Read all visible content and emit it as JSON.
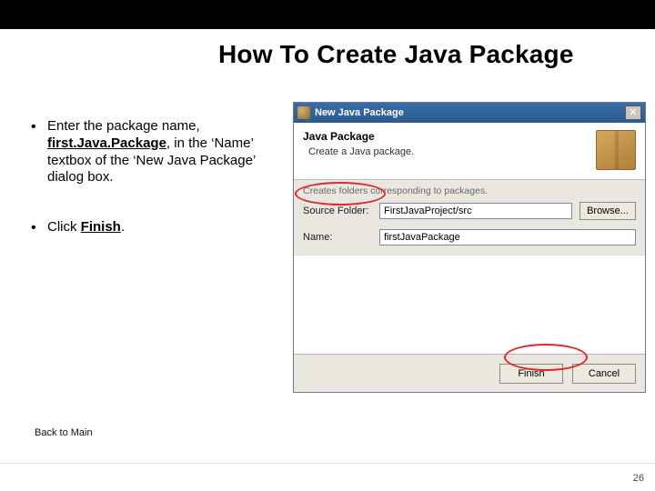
{
  "slide": {
    "title": "How To Create Java Package",
    "bullets": [
      {
        "pre": "Enter the package name, ",
        "em": "first.Java.Package",
        "post": ", in the ‘Name’ textbox of the ‘New Java Package’ dialog box."
      },
      {
        "pre": "Click ",
        "em": "Finish",
        "post": "."
      }
    ],
    "back_label": "Back to Main",
    "page_number": "26"
  },
  "dialog": {
    "titlebar": "New Java Package",
    "banner_title": "Java Package",
    "banner_sub": "Create a Java package.",
    "note": "Creates folders corresponding to packages.",
    "source_folder_label": "Source Folder:",
    "source_folder_value": "FirstJavaProject/src",
    "browse_label": "Browse...",
    "name_label": "Name:",
    "name_value": "firstJavaPackage",
    "finish_label": "Finish",
    "cancel_label": "Cancel",
    "close_glyph": "✕"
  }
}
